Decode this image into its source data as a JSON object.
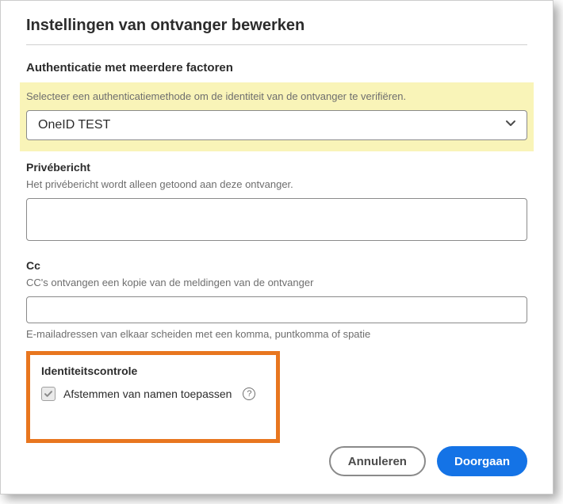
{
  "dialog": {
    "title": "Instellingen van ontvanger bewerken"
  },
  "mfa": {
    "heading": "Authenticatie met meerdere factoren",
    "helper": "Selecteer een authenticatiemethode om de identiteit van de ontvanger te verifiëren.",
    "selected": "OneID TEST"
  },
  "private_message": {
    "heading": "Privébericht",
    "helper": "Het privébericht wordt alleen getoond aan deze ontvanger.",
    "value": ""
  },
  "cc": {
    "heading": "Cc",
    "helper": "CC's ontvangen een kopie van de meldingen van de ontvanger",
    "value": "",
    "hint": "E-mailadressen van elkaar scheiden met een komma, puntkomma of spatie"
  },
  "identity": {
    "heading": "Identiteitscontrole",
    "checkbox_label": "Afstemmen van namen toepassen",
    "checked": true
  },
  "footer": {
    "cancel": "Annuleren",
    "continue": "Doorgaan"
  },
  "icons": {
    "help_glyph": "?"
  }
}
